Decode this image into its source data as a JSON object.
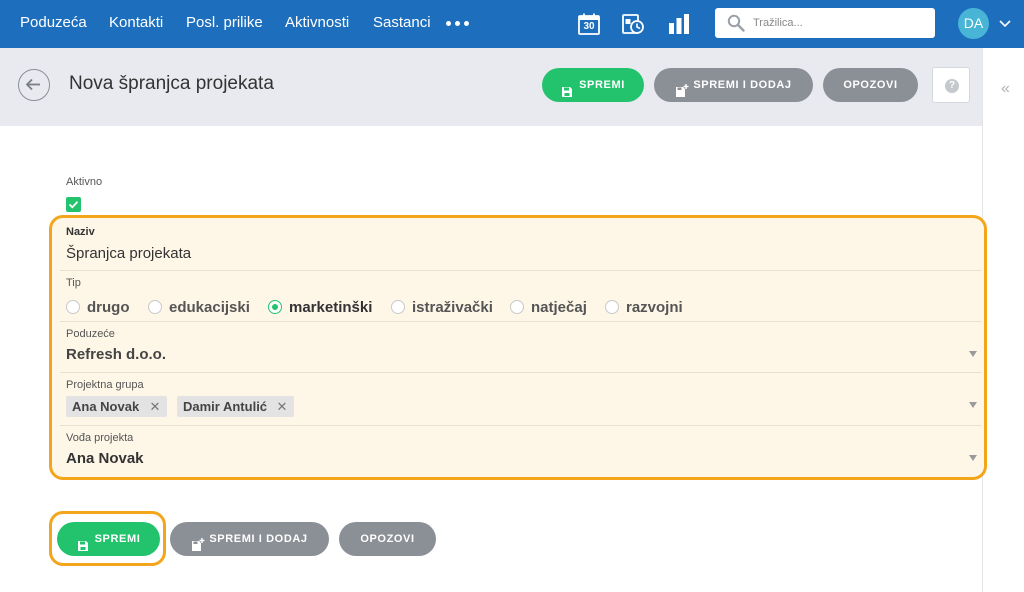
{
  "nav": {
    "items": [
      "Poduzeća",
      "Kontakti",
      "Posl. prilike",
      "Aktivnosti",
      "Sastanci"
    ],
    "calendar_day": "30",
    "search_placeholder": "Tražilica...",
    "avatar_initials": "DA",
    "icons": [
      "more-dots-icon",
      "calendar-icon",
      "task-calendar-icon",
      "bar-chart-icon",
      "search-icon",
      "chevron-down-icon"
    ]
  },
  "header": {
    "title": "Nova špranjca projekata",
    "save": "SPREMI",
    "save_add": "SPREMI I DODAJ",
    "cancel": "OPOZOVI",
    "help": "?"
  },
  "form": {
    "aktivno_label": "Aktivno",
    "aktivno_checked": true,
    "naziv_label": "Naziv",
    "naziv_value": "Špranjca projekata",
    "tip_label": "Tip",
    "tip_options": [
      "drugo",
      "edukacijski",
      "marketinški",
      "istraživački",
      "natječaj",
      "razvojni"
    ],
    "tip_selected": "marketinški",
    "poduzece_label": "Poduzeće",
    "poduzece_value": "Refresh d.o.o.",
    "grupa_label": "Projektna grupa",
    "grupa_tags": [
      "Ana Novak",
      "Damir Antulić"
    ],
    "voda_label": "Vođa projekta",
    "voda_value": "Ana Novak"
  },
  "footer": {
    "save": "SPREMI",
    "save_add": "SPREMI I DODAJ",
    "cancel": "OPOZOVI"
  },
  "colors": {
    "nav": "#1d6fbd",
    "accent_green": "#23c36e",
    "button_gray": "#8b8f96",
    "highlight_orange": "#f3a51c",
    "highlight_fill": "#fef7e8"
  }
}
